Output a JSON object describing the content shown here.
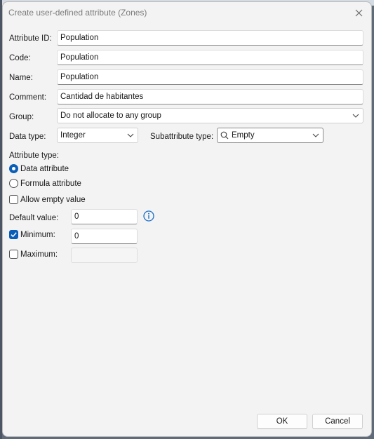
{
  "dialog": {
    "title": "Create user-defined attribute (Zones)",
    "close_icon": "close-icon"
  },
  "fields": {
    "attribute_id": {
      "label": "Attribute ID:",
      "value": "Population"
    },
    "code": {
      "label": "Code:",
      "value": "Population"
    },
    "name": {
      "label": "Name:",
      "value": "Population"
    },
    "comment": {
      "label": "Comment:",
      "value": "Cantidad de habitantes"
    },
    "group": {
      "label": "Group:",
      "value": "Do not allocate to any group"
    },
    "data_type": {
      "label": "Data type:",
      "value": "Integer"
    },
    "subattribute_type": {
      "label": "Subattribute type:",
      "value": "Empty",
      "icon": "search-icon"
    }
  },
  "attribute_type": {
    "label": "Attribute type:",
    "options": [
      {
        "label": "Data attribute",
        "selected": true
      },
      {
        "label": "Formula attribute",
        "selected": false
      }
    ]
  },
  "allow_empty": {
    "label": "Allow empty value",
    "checked": false
  },
  "default_value": {
    "label": "Default value:",
    "value": "0",
    "icon": "info-icon"
  },
  "minimum": {
    "label": "Minimum:",
    "checked": true,
    "value": "0"
  },
  "maximum": {
    "label": "Maximum:",
    "checked": false,
    "value": ""
  },
  "buttons": {
    "ok": "OK",
    "cancel": "Cancel"
  },
  "colors": {
    "accent": "#0a5eb8",
    "dialog_bg": "#f3f3f3"
  }
}
